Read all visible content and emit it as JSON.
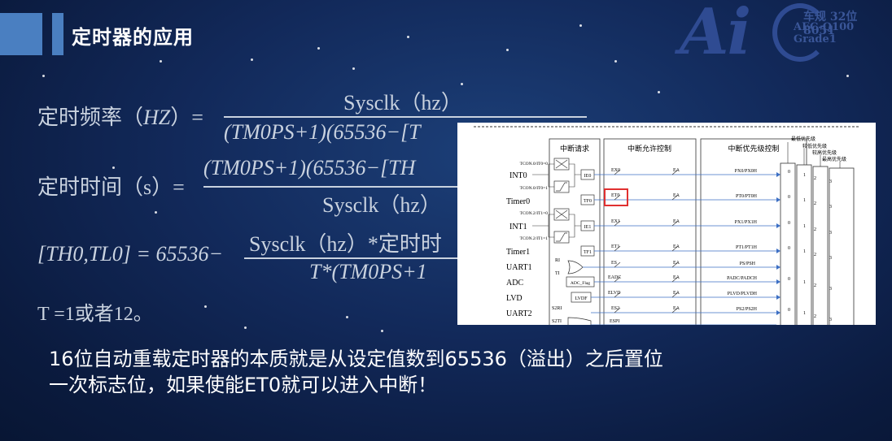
{
  "header": {
    "title": "定时器的应用"
  },
  "logo": {
    "brand": "Ai",
    "line1": "车规 32位 8051",
    "line2": "AEC-Q100 Grade1"
  },
  "formulas": {
    "freq": {
      "label": "定时频率（",
      "var": "HZ",
      "close": "）=",
      "num": "Sysclk（hz）",
      "den": "(TM0PS+1)(65536−[T"
    },
    "time": {
      "label": "定时时间（s）=",
      "num": "(TM0PS+1)(65536−[TH",
      "den": "Sysclk（hz）"
    },
    "reload": {
      "lhs": "[TH0,TL0] = 65536−",
      "num": "Sysclk（hz）*定时时",
      "den": "T*(TM0PS+1"
    },
    "t": {
      "text": "T =1或者12。"
    }
  },
  "diagram": {
    "headers": {
      "request": "中断请求",
      "enable": "中断允许控制",
      "priority": "中断优先级控制"
    },
    "priority_labels": [
      "最低优先级",
      "较低优先级",
      "较高优先级",
      "最高优先级"
    ],
    "sources": [
      "INT0",
      "Timer0",
      "INT1",
      "Timer1",
      "UART1",
      "ADC",
      "LVD",
      "UART2"
    ],
    "tcon": [
      "TCON.0/IT0=0",
      "TCON.0/IT0=1",
      "TCON.2/IT1=0",
      "TCON.2/IT1=1"
    ],
    "flags": [
      "IE0",
      "TF0",
      "IE1",
      "TF1",
      "ADC_Flag",
      "LVDF"
    ],
    "or_inputs": [
      "RI",
      "TI",
      "S2RI",
      "S2TI"
    ],
    "enables": [
      "EX0",
      "ET0",
      "EX1",
      "ET1",
      "ES",
      "EADC",
      "ELVD",
      "ES2",
      "ESPI"
    ],
    "ea": "EA",
    "priorities": [
      "PX0/PX0H",
      "PT0/PT0H",
      "PX1/PX1H",
      "PT1/PT1H",
      "PS/PSH",
      "PADC/PADCH",
      "PLVD/PLVDH",
      "PS2/PS2H"
    ],
    "levels": [
      "0",
      "1",
      "2",
      "3"
    ],
    "highlight_color": "#e03030"
  },
  "summary": {
    "line1": "16位自动重载定时器的本质就是从设定值数到65536（溢出）之后置位",
    "line2": "一次标志位，如果使能ET0就可以进入中断！"
  }
}
